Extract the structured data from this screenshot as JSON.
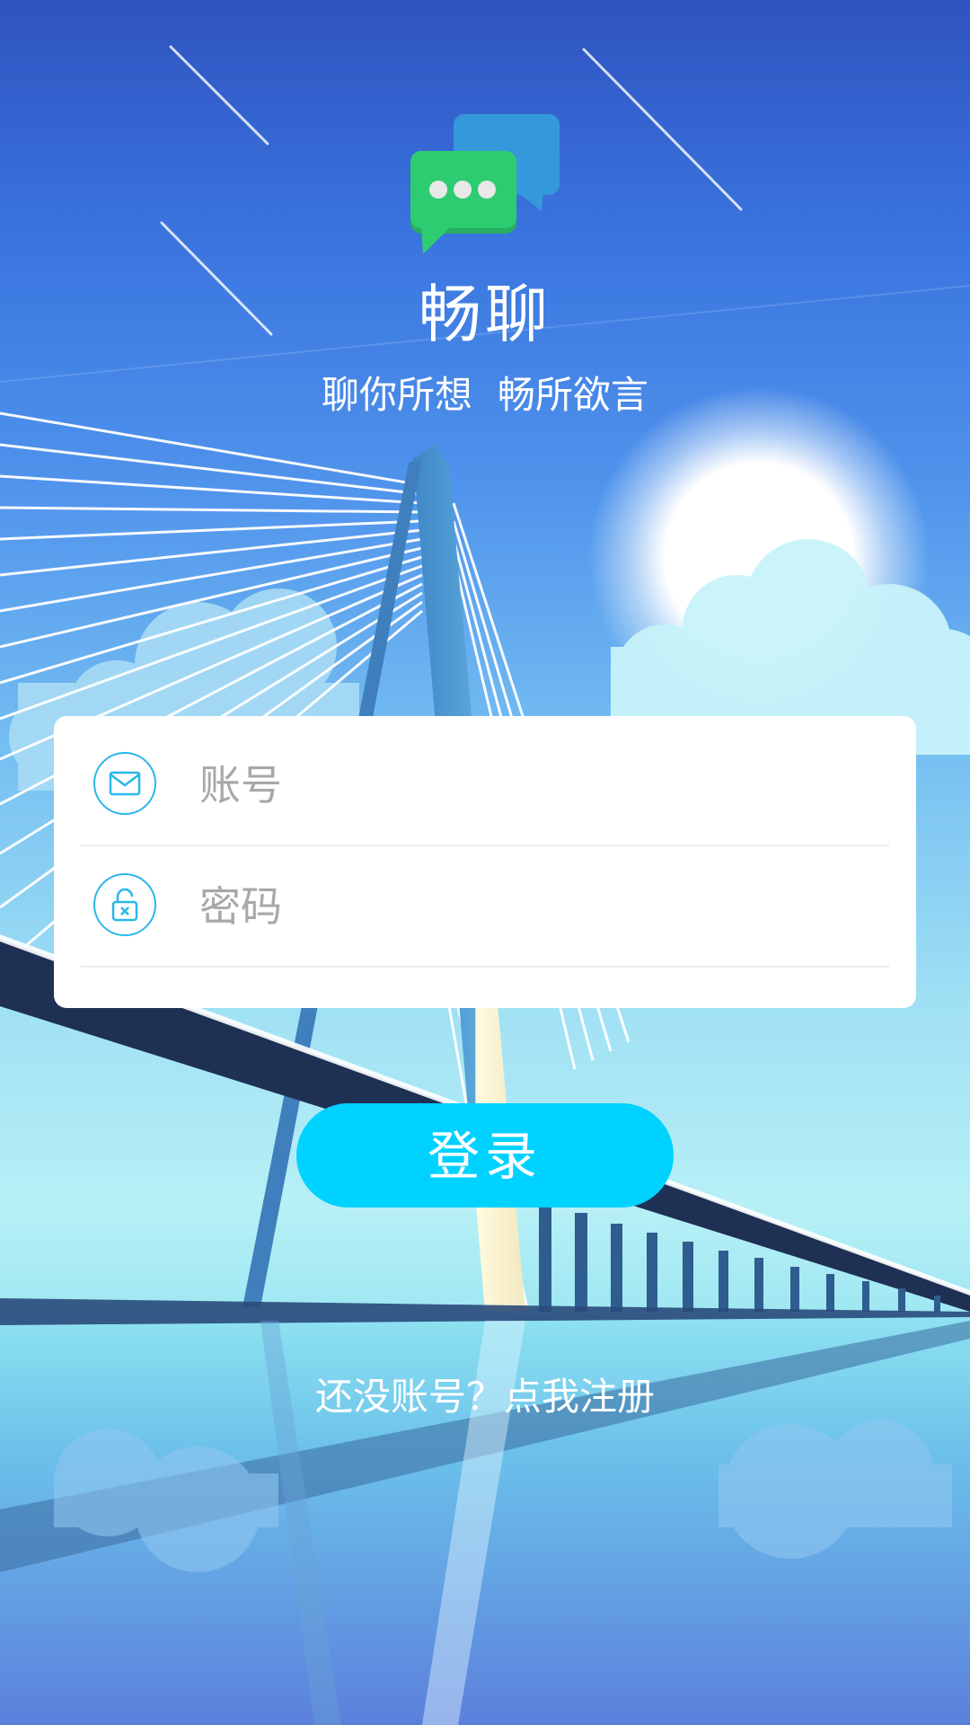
{
  "app": {
    "title": "畅聊",
    "slogan_part1": "聊你所想",
    "slogan_part2": "畅所欲言"
  },
  "login_form": {
    "account_placeholder": "账号",
    "password_placeholder": "密码",
    "account_icon": "mail-icon",
    "password_icon": "lock-icon"
  },
  "actions": {
    "login_label": "登录",
    "register_link": "还没账号？点我注册"
  },
  "colors": {
    "accent": "#00d2ff",
    "icon_stroke": "#29b7e8",
    "logo_green": "#2ecc71",
    "logo_blue": "#3498db"
  }
}
